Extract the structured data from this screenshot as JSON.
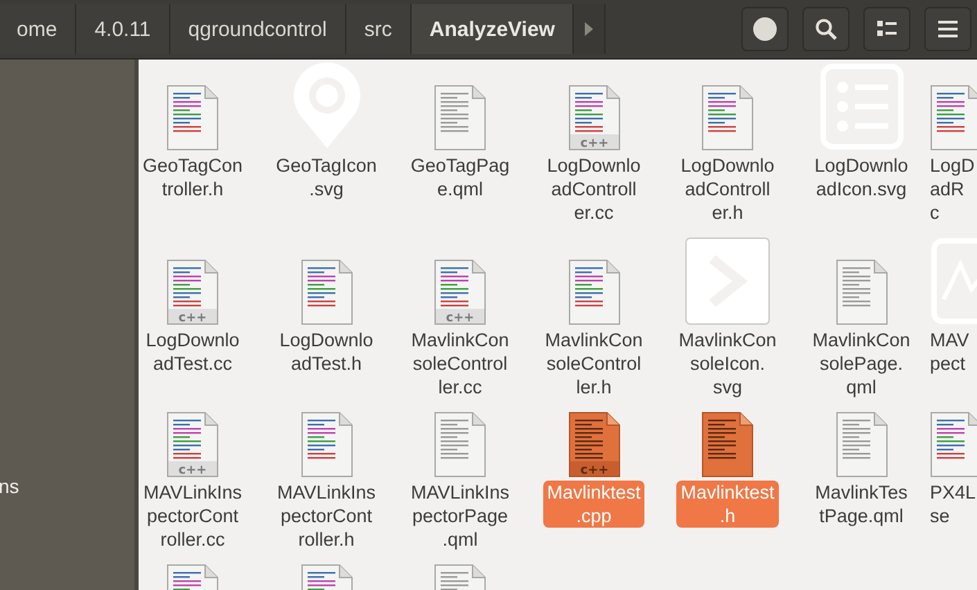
{
  "breadcrumbs": [
    {
      "label": "ome",
      "selected": false
    },
    {
      "label": "4.0.11",
      "selected": false
    },
    {
      "label": "qgroundcontrol",
      "selected": false
    },
    {
      "label": "src",
      "selected": false
    },
    {
      "label": "AnalyzeView",
      "selected": true
    }
  ],
  "sidebar": {
    "items": [
      {
        "label": "ns"
      }
    ]
  },
  "files": [
    {
      "kind": "source",
      "lines": [
        "GeoTagCon",
        "troller.h"
      ],
      "selected": false
    },
    {
      "kind": "pin",
      "lines": [
        "GeoTagIcon",
        ".svg"
      ],
      "selected": false
    },
    {
      "kind": "text",
      "lines": [
        "GeoTagPag",
        "e.qml"
      ],
      "selected": false
    },
    {
      "kind": "source",
      "icon_text": "c++",
      "lines": [
        "LogDownlo",
        "adControll",
        "er.cc"
      ],
      "selected": false
    },
    {
      "kind": "source",
      "lines": [
        "LogDownlo",
        "adControll",
        "er.h"
      ],
      "selected": false
    },
    {
      "kind": "list",
      "lines": [
        "LogDownlo",
        "adIcon.svg"
      ],
      "selected": false
    },
    {
      "kind": "source",
      "lines": [
        "LogD",
        "adR",
        "c"
      ],
      "selected": false
    },
    {
      "kind": "source",
      "icon_text": "c++",
      "lines": [
        "LogDownlo",
        "adTest.cc"
      ],
      "selected": false
    },
    {
      "kind": "source",
      "lines": [
        "LogDownlo",
        "adTest.h"
      ],
      "selected": false
    },
    {
      "kind": "source",
      "icon_text": "c++",
      "lines": [
        "MavlinkCon",
        "soleControl",
        "ler.cc"
      ],
      "selected": false
    },
    {
      "kind": "source",
      "lines": [
        "MavlinkCon",
        "soleControl",
        "ler.h"
      ],
      "selected": false
    },
    {
      "kind": "prompt",
      "lines": [
        "MavlinkCon",
        "soleIcon.",
        "svg"
      ],
      "selected": false
    },
    {
      "kind": "text",
      "lines": [
        "MavlinkCon",
        "solePage.",
        "qml"
      ],
      "selected": false
    },
    {
      "kind": "chart",
      "lines": [
        "MAV",
        "pect"
      ],
      "selected": false
    },
    {
      "kind": "source",
      "icon_text": "c++",
      "lines": [
        "MAVLinkIns",
        "pectorCont",
        "roller.cc"
      ],
      "selected": false
    },
    {
      "kind": "source",
      "lines": [
        "MAVLinkIns",
        "pectorCont",
        "roller.h"
      ],
      "selected": false
    },
    {
      "kind": "text",
      "lines": [
        "MAVLinkIns",
        "pectorPage",
        ".qml"
      ],
      "selected": false
    },
    {
      "kind": "source",
      "icon_text": "c++",
      "lines": [
        "Mavlinktest",
        ".cpp"
      ],
      "selected": true
    },
    {
      "kind": "source",
      "lines": [
        "Mavlinktest",
        ".h"
      ],
      "selected": true
    },
    {
      "kind": "text",
      "lines": [
        "MavlinkTes",
        "tPage.qml"
      ],
      "selected": false
    },
    {
      "kind": "source",
      "lines": [
        "PX4L",
        "se"
      ],
      "selected": false
    },
    {
      "kind": "source",
      "selected": false
    },
    {
      "kind": "source",
      "selected": false
    },
    {
      "kind": "text",
      "selected": false
    }
  ]
}
